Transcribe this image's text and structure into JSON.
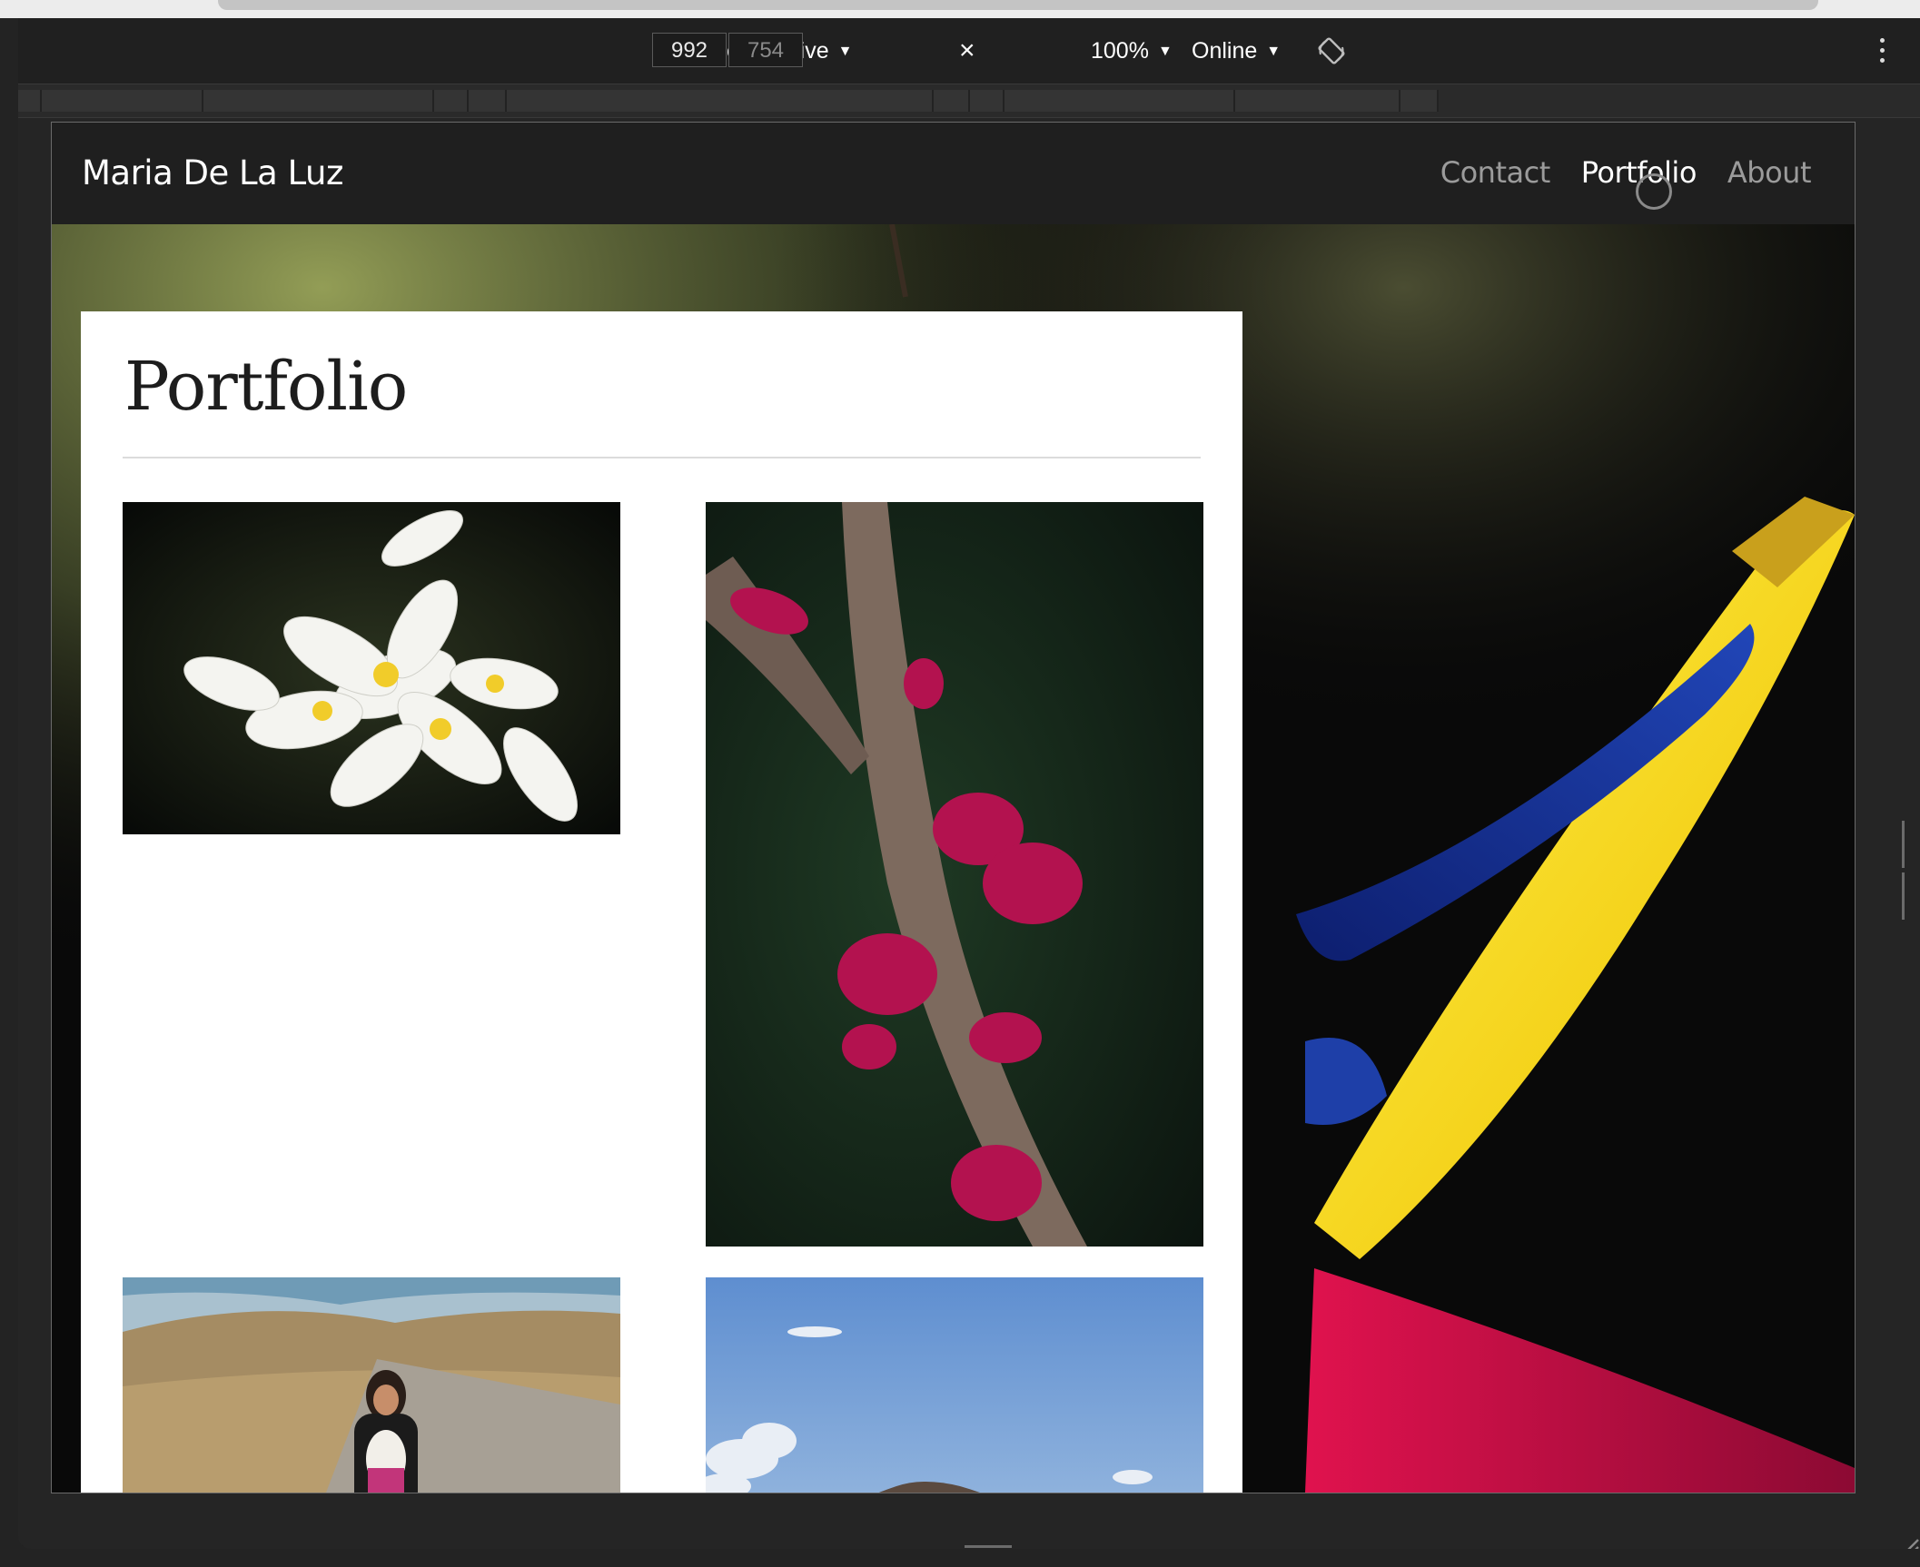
{
  "device_toolbar": {
    "device": "Responsive",
    "width": "992",
    "height": "754",
    "zoom": "100%",
    "network": "Online",
    "times_symbol": "×",
    "rotate_icon": "rotate-icon",
    "more_icon": "kebab-menu-icon"
  },
  "site": {
    "brand": "Maria De La Luz",
    "nav": [
      "Contact",
      "Portfolio",
      "About"
    ],
    "active_nav": "Portfolio"
  },
  "page": {
    "title": "Portfolio"
  },
  "gallery": [
    {
      "subject": "white plumeria flowers"
    },
    {
      "subject": "magenta blossoms on branch"
    },
    {
      "subject": "woman with dog on dirt road"
    },
    {
      "subject": "mountain under blue sky"
    }
  ],
  "hero_subject": "bird of paradise flower",
  "colors": {
    "nav_bg": "#1f1f1f",
    "toolbar_bg": "#202020",
    "nav_link": "#9b9b9b",
    "nav_link_active": "#ffffff",
    "card_bg": "#ffffff"
  }
}
